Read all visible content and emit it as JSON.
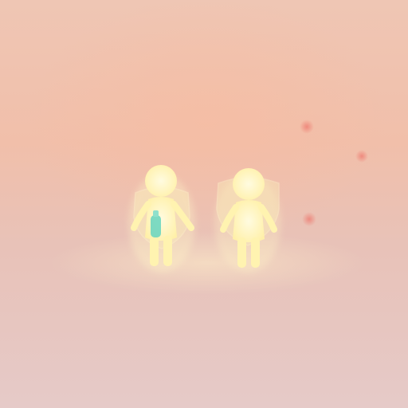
{
  "scene": {
    "colors": {
      "background": "#efc6b4",
      "figure_body": "#fff3b0",
      "shield": "#f7e6b0",
      "vial": "#6fd6c0",
      "particle": "#ee786e"
    },
    "figures": [
      {
        "icon": "child-figure-with-shield-icon",
        "holds_vial": true
      },
      {
        "icon": "child-figure-with-shield-icon",
        "holds_vial": false
      }
    ],
    "particles": 3
  }
}
